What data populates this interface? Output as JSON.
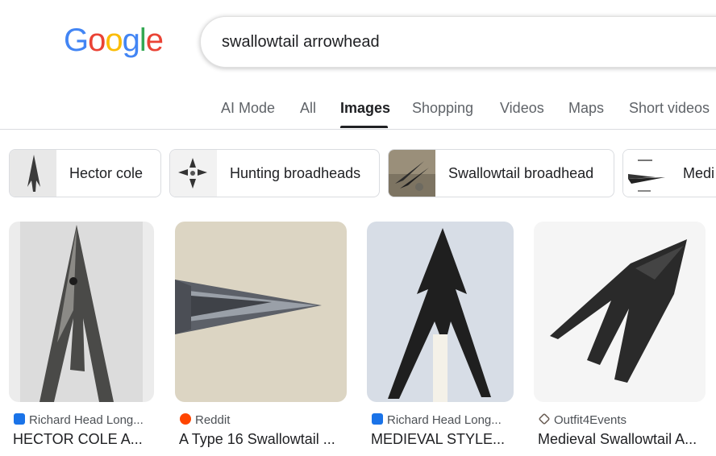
{
  "logo": {
    "letters": [
      "G",
      "o",
      "o",
      "g",
      "l",
      "e"
    ],
    "colors": [
      "#4285F4",
      "#EA4335",
      "#FBBC05",
      "#4285F4",
      "#34A853",
      "#EA4335"
    ]
  },
  "search": {
    "query": "swallowtail arrowhead"
  },
  "tabs": [
    {
      "label": "AI Mode"
    },
    {
      "label": "All"
    },
    {
      "label": "Images",
      "active": true
    },
    {
      "label": "Shopping"
    },
    {
      "label": "Videos"
    },
    {
      "label": "Maps"
    },
    {
      "label": "Short videos"
    }
  ],
  "chips": [
    {
      "label": "Hector cole"
    },
    {
      "label": "Hunting broadheads"
    },
    {
      "label": "Swallowtail broadhead"
    },
    {
      "label": "Medi"
    }
  ],
  "results": [
    {
      "source": "Richard Head Long...",
      "title": "HECTOR COLE A...",
      "favicon": "bookmark-icon",
      "favicon_color": "#1a73e8"
    },
    {
      "source": "Reddit",
      "title": "A Type 16 Swallowtail ...",
      "favicon": "reddit-icon",
      "favicon_color": "#ff4500"
    },
    {
      "source": "Richard Head Long...",
      "title": "MEDIEVAL STYLE...",
      "favicon": "bookmark-icon",
      "favicon_color": "#1a73e8"
    },
    {
      "source": "Outfit4Events",
      "title": "Medieval Swallowtail A...",
      "favicon": "diamond-icon",
      "favicon_color": "#5f6368"
    }
  ]
}
